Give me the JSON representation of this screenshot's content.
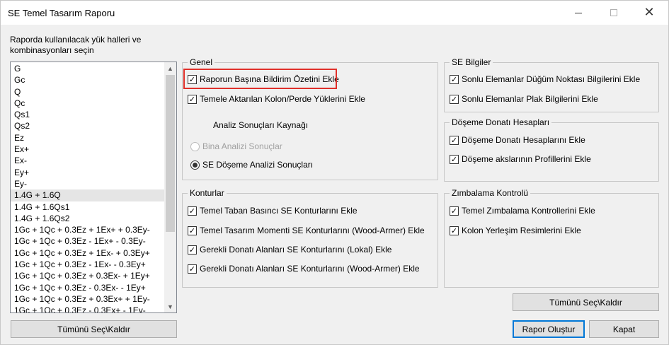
{
  "window": {
    "title": "SE Temel Tasarım Raporu",
    "close_glyph": "✕"
  },
  "left": {
    "caption": "Raporda kullanılacak yük halleri ve kombinasyonları seçin",
    "items": [
      "G",
      "Gc",
      "Q",
      "Qc",
      "Qs1",
      "Qs2",
      "Ez",
      "Ex+",
      "Ex-",
      "Ey+",
      "Ey-",
      "1.4G + 1.6Q",
      "1.4G + 1.6Qs1",
      "1.4G + 1.6Qs2",
      "1Gc + 1Qc + 0.3Ez + 1Ex+ + 0.3Ey-",
      "1Gc + 1Qc + 0.3Ez - 1Ex+ - 0.3Ey-",
      "1Gc + 1Qc + 0.3Ez + 1Ex- + 0.3Ey+",
      "1Gc + 1Qc + 0.3Ez - 1Ex- - 0.3Ey+",
      "1Gc + 1Qc + 0.3Ez + 0.3Ex- + 1Ey+",
      "1Gc + 1Qc + 0.3Ez - 0.3Ex- - 1Ey+",
      "1Gc + 1Qc + 0.3Ez + 0.3Ex+ + 1Ey-",
      "1Gc + 1Qc + 0.3Ez - 0.3Ex+ - 1Ey-"
    ],
    "selected_index": 11,
    "select_all_label": "Tümünü Seç\\Kaldır"
  },
  "genel": {
    "title": "Genel",
    "opt1": {
      "label": "Raporun Başına Bildirim Özetini Ekle",
      "checked": true
    },
    "opt2": {
      "label": "Temele Aktarılan Kolon/Perde Yüklerini Ekle",
      "checked": true
    },
    "source_label": "Analiz Sonuçları Kaynağı",
    "radio1": {
      "label": "Bina Analizi Sonuçlar",
      "selected": false,
      "enabled": false
    },
    "radio2": {
      "label": "SE Döşeme Analizi Sonuçları",
      "selected": true,
      "enabled": true
    }
  },
  "konturlar": {
    "title": "Konturlar",
    "opt1": {
      "label": "Temel Taban Basıncı SE Konturlarını Ekle",
      "checked": true
    },
    "opt2": {
      "label": "Temel Tasarım Momenti SE Konturlarını (Wood-Armer) Ekle",
      "checked": true
    },
    "opt3": {
      "label": "Gerekli Donatı Alanları SE Konturlarını (Lokal) Ekle",
      "checked": true
    },
    "opt4": {
      "label": "Gerekli Donatı Alanları SE Konturlarını (Wood-Armer) Ekle",
      "checked": true
    }
  },
  "se_bilgiler": {
    "title": "SE Bilgiler",
    "opt1": {
      "label": "Sonlu Elemanlar Düğüm Noktası Bilgilerini Ekle",
      "checked": true
    },
    "opt2": {
      "label": "Sonlu Elemanlar Plak Bilgilerini Ekle",
      "checked": true
    }
  },
  "doseme": {
    "title": "Döşeme Donatı Hesapları",
    "opt1": {
      "label": "Döşeme Donatı Hesaplarını Ekle",
      "checked": true
    },
    "opt2": {
      "label": "Döşeme akslarının Profillerini Ekle",
      "checked": true
    }
  },
  "zimbalama": {
    "title": "Zımbalama Kontrolü",
    "opt1": {
      "label": "Temel Zımbalama Kontrollerini Ekle",
      "checked": true
    },
    "opt2": {
      "label": "Kolon Yerleşim Resimlerini Ekle",
      "checked": true
    }
  },
  "buttons": {
    "select_all_right": "Tümünü Seç\\Kaldır",
    "create_report": "Rapor Oluştur",
    "close": "Kapat"
  },
  "glyphs": {
    "check": "✓",
    "scroll_up": "▲",
    "scroll_down": "▼"
  },
  "colors": {
    "highlight": "#e0302a",
    "accent": "#0078d7"
  }
}
